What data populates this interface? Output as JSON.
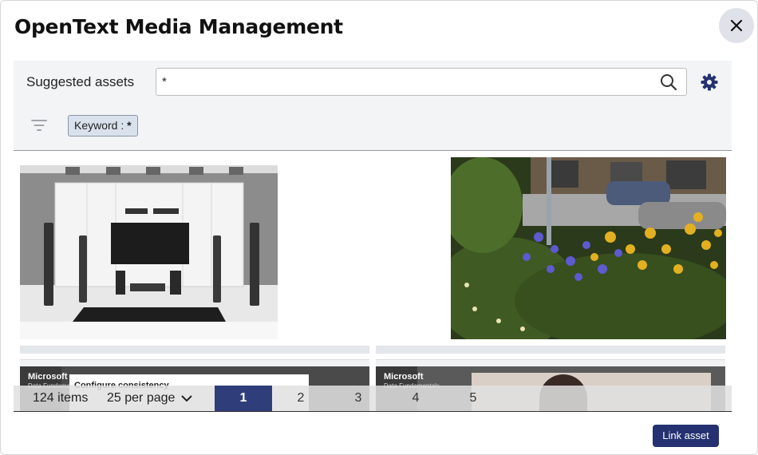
{
  "dialog": {
    "title": "OpenText Media Management"
  },
  "search": {
    "label": "Suggested assets",
    "value": "*"
  },
  "filter": {
    "chip_key": "Keyword",
    "chip_sep": " : ",
    "chip_value": "*"
  },
  "thumbnails": [
    {
      "alt": "home theater room"
    },
    {
      "alt": "flowers in street garden"
    },
    {
      "text": "Microsoft",
      "sub": "Data Fundamentals",
      "caption": "Configure consistency"
    },
    {
      "text": "Microsoft",
      "sub": "Data Fundamentals"
    }
  ],
  "pagination": {
    "total": "124 items",
    "per_page": "25 per page",
    "pages": [
      "1",
      "2",
      "3",
      "4",
      "5"
    ],
    "current_page": 1
  },
  "actions": {
    "link_asset": "Link asset"
  },
  "colors": {
    "primary": "#253170",
    "active_page": "#2f3e7a"
  }
}
